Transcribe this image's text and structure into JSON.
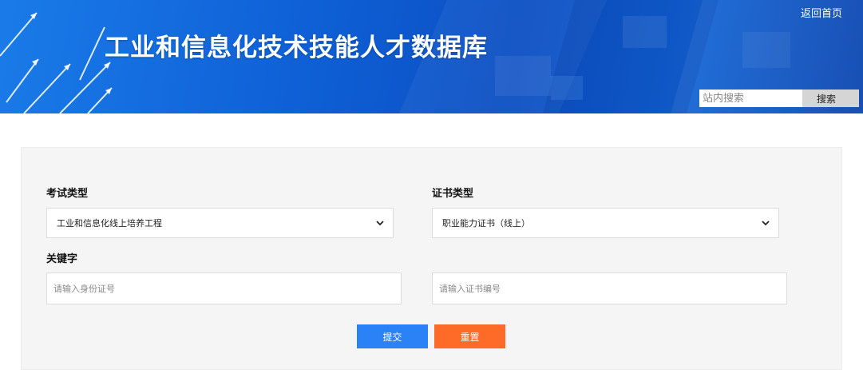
{
  "header": {
    "title": "工业和信息化技术技能人才数据库",
    "home_link": "返回首页",
    "search": {
      "placeholder": "站内搜索",
      "value": "",
      "button_label": "搜索"
    }
  },
  "form": {
    "exam_type": {
      "label": "考试类型",
      "selected": "工业和信息化线上培养工程"
    },
    "cert_type": {
      "label": "证书类型",
      "selected": "职业能力证书（线上）"
    },
    "keyword": {
      "label": "关键字",
      "id_placeholder": "请输入身份证号",
      "cert_no_placeholder": "请输入证书编号"
    },
    "submit_label": "提交",
    "reset_label": "重置"
  },
  "colors": {
    "banner_blue": "#0f60d6",
    "submit": "#2b82f6",
    "reset": "#fe6a27",
    "panel_bg": "#f5f5f5"
  }
}
